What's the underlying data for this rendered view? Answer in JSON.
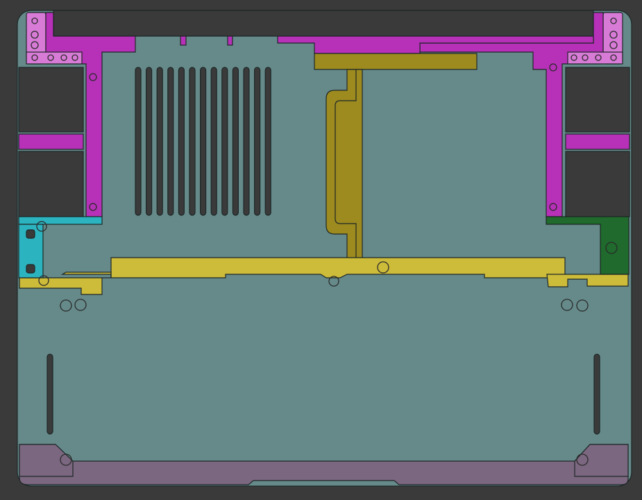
{
  "colors": {
    "background": "#3a3a3a",
    "body": "#668a8a",
    "magenta": "#b730b8",
    "magenta-light": "#d77bd6",
    "yellow": "#cdbb3a",
    "olive": "#9d8b1f",
    "cyan": "#2cb3c0",
    "green": "#1f6a2c",
    "purple": "#7b6780",
    "dark": "#3a3a3a"
  },
  "vent_slot_count": 13
}
